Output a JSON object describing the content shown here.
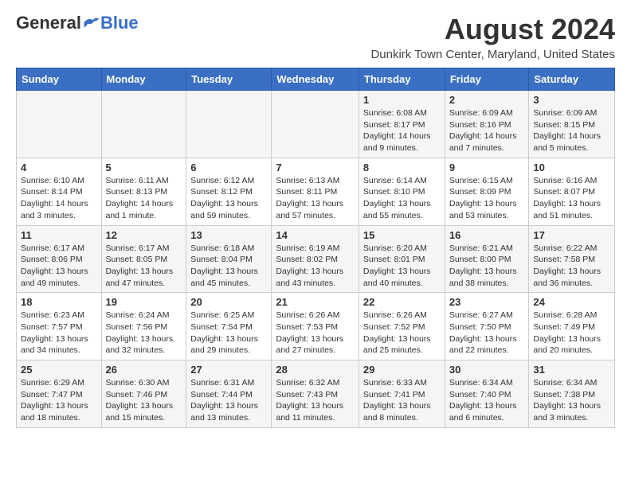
{
  "logo": {
    "general": "General",
    "blue": "Blue"
  },
  "header": {
    "month_year": "August 2024",
    "location": "Dunkirk Town Center, Maryland, United States"
  },
  "weekdays": [
    "Sunday",
    "Monday",
    "Tuesday",
    "Wednesday",
    "Thursday",
    "Friday",
    "Saturday"
  ],
  "weeks": [
    [
      {
        "day": "",
        "info": ""
      },
      {
        "day": "",
        "info": ""
      },
      {
        "day": "",
        "info": ""
      },
      {
        "day": "",
        "info": ""
      },
      {
        "day": "1",
        "info": "Sunrise: 6:08 AM\nSunset: 8:17 PM\nDaylight: 14 hours\nand 9 minutes."
      },
      {
        "day": "2",
        "info": "Sunrise: 6:09 AM\nSunset: 8:16 PM\nDaylight: 14 hours\nand 7 minutes."
      },
      {
        "day": "3",
        "info": "Sunrise: 6:09 AM\nSunset: 8:15 PM\nDaylight: 14 hours\nand 5 minutes."
      }
    ],
    [
      {
        "day": "4",
        "info": "Sunrise: 6:10 AM\nSunset: 8:14 PM\nDaylight: 14 hours\nand 3 minutes."
      },
      {
        "day": "5",
        "info": "Sunrise: 6:11 AM\nSunset: 8:13 PM\nDaylight: 14 hours\nand 1 minute."
      },
      {
        "day": "6",
        "info": "Sunrise: 6:12 AM\nSunset: 8:12 PM\nDaylight: 13 hours\nand 59 minutes."
      },
      {
        "day": "7",
        "info": "Sunrise: 6:13 AM\nSunset: 8:11 PM\nDaylight: 13 hours\nand 57 minutes."
      },
      {
        "day": "8",
        "info": "Sunrise: 6:14 AM\nSunset: 8:10 PM\nDaylight: 13 hours\nand 55 minutes."
      },
      {
        "day": "9",
        "info": "Sunrise: 6:15 AM\nSunset: 8:09 PM\nDaylight: 13 hours\nand 53 minutes."
      },
      {
        "day": "10",
        "info": "Sunrise: 6:16 AM\nSunset: 8:07 PM\nDaylight: 13 hours\nand 51 minutes."
      }
    ],
    [
      {
        "day": "11",
        "info": "Sunrise: 6:17 AM\nSunset: 8:06 PM\nDaylight: 13 hours\nand 49 minutes."
      },
      {
        "day": "12",
        "info": "Sunrise: 6:17 AM\nSunset: 8:05 PM\nDaylight: 13 hours\nand 47 minutes."
      },
      {
        "day": "13",
        "info": "Sunrise: 6:18 AM\nSunset: 8:04 PM\nDaylight: 13 hours\nand 45 minutes."
      },
      {
        "day": "14",
        "info": "Sunrise: 6:19 AM\nSunset: 8:02 PM\nDaylight: 13 hours\nand 43 minutes."
      },
      {
        "day": "15",
        "info": "Sunrise: 6:20 AM\nSunset: 8:01 PM\nDaylight: 13 hours\nand 40 minutes."
      },
      {
        "day": "16",
        "info": "Sunrise: 6:21 AM\nSunset: 8:00 PM\nDaylight: 13 hours\nand 38 minutes."
      },
      {
        "day": "17",
        "info": "Sunrise: 6:22 AM\nSunset: 7:58 PM\nDaylight: 13 hours\nand 36 minutes."
      }
    ],
    [
      {
        "day": "18",
        "info": "Sunrise: 6:23 AM\nSunset: 7:57 PM\nDaylight: 13 hours\nand 34 minutes."
      },
      {
        "day": "19",
        "info": "Sunrise: 6:24 AM\nSunset: 7:56 PM\nDaylight: 13 hours\nand 32 minutes."
      },
      {
        "day": "20",
        "info": "Sunrise: 6:25 AM\nSunset: 7:54 PM\nDaylight: 13 hours\nand 29 minutes."
      },
      {
        "day": "21",
        "info": "Sunrise: 6:26 AM\nSunset: 7:53 PM\nDaylight: 13 hours\nand 27 minutes."
      },
      {
        "day": "22",
        "info": "Sunrise: 6:26 AM\nSunset: 7:52 PM\nDaylight: 13 hours\nand 25 minutes."
      },
      {
        "day": "23",
        "info": "Sunrise: 6:27 AM\nSunset: 7:50 PM\nDaylight: 13 hours\nand 22 minutes."
      },
      {
        "day": "24",
        "info": "Sunrise: 6:28 AM\nSunset: 7:49 PM\nDaylight: 13 hours\nand 20 minutes."
      }
    ],
    [
      {
        "day": "25",
        "info": "Sunrise: 6:29 AM\nSunset: 7:47 PM\nDaylight: 13 hours\nand 18 minutes."
      },
      {
        "day": "26",
        "info": "Sunrise: 6:30 AM\nSunset: 7:46 PM\nDaylight: 13 hours\nand 15 minutes."
      },
      {
        "day": "27",
        "info": "Sunrise: 6:31 AM\nSunset: 7:44 PM\nDaylight: 13 hours\nand 13 minutes."
      },
      {
        "day": "28",
        "info": "Sunrise: 6:32 AM\nSunset: 7:43 PM\nDaylight: 13 hours\nand 11 minutes."
      },
      {
        "day": "29",
        "info": "Sunrise: 6:33 AM\nSunset: 7:41 PM\nDaylight: 13 hours\nand 8 minutes."
      },
      {
        "day": "30",
        "info": "Sunrise: 6:34 AM\nSunset: 7:40 PM\nDaylight: 13 hours\nand 6 minutes."
      },
      {
        "day": "31",
        "info": "Sunrise: 6:34 AM\nSunset: 7:38 PM\nDaylight: 13 hours\nand 3 minutes."
      }
    ]
  ]
}
